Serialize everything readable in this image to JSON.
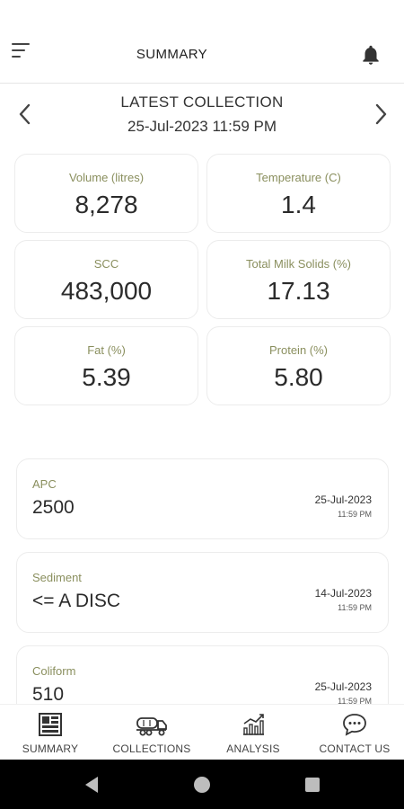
{
  "header": {
    "title": "SUMMARY",
    "menu_icon": "hamburger-menu-icon",
    "notification_icon": "bell-icon"
  },
  "collection": {
    "heading": "LATEST COLLECTION",
    "datetime": "25-Jul-2023 11:59 PM"
  },
  "metrics": [
    {
      "label": "Volume (litres)",
      "value": "8,278"
    },
    {
      "label": "Temperature (C)",
      "value": "1.4"
    },
    {
      "label": "SCC",
      "value": "483,000"
    },
    {
      "label": "Total Milk Solids (%)",
      "value": "17.13"
    },
    {
      "label": "Fat (%)",
      "value": "5.39"
    },
    {
      "label": "Protein (%)",
      "value": "5.80"
    }
  ],
  "tests": [
    {
      "label": "APC",
      "value": "2500",
      "date": "25-Jul-2023",
      "time": "11:59 PM"
    },
    {
      "label": "Sediment",
      "value": "<= A DISC",
      "date": "14-Jul-2023",
      "time": "11:59 PM"
    },
    {
      "label": "Coliform",
      "value": "510",
      "date": "25-Jul-2023",
      "time": "11:59 PM"
    }
  ],
  "tabs": [
    {
      "label": "SUMMARY",
      "icon": "summary-icon"
    },
    {
      "label": "COLLECTIONS",
      "icon": "milk-tanker-icon"
    },
    {
      "label": "ANALYSIS",
      "icon": "analysis-chart-icon"
    },
    {
      "label": "CONTACT US",
      "icon": "chat-bubble-icon"
    }
  ],
  "colors": {
    "label_accent": "#8a8f5e",
    "text_dark": "#2b2b2b",
    "system_nav": "#000000"
  }
}
